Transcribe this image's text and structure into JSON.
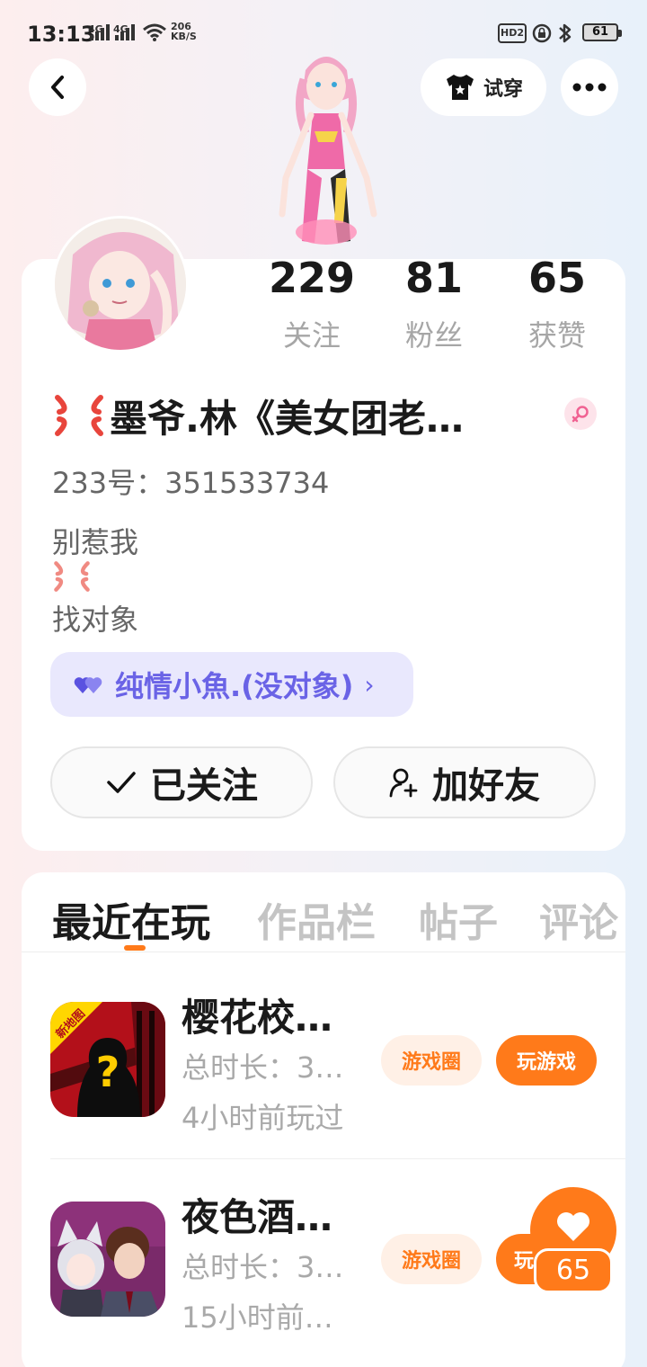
{
  "status_bar": {
    "time": "13:13",
    "network_1": "4G",
    "network_2": "4G",
    "speed_value": "206",
    "speed_unit": "KB/S",
    "hd_label": "HD2",
    "battery": "61"
  },
  "header": {
    "tryon_label": "试穿"
  },
  "profile": {
    "stats": [
      {
        "value": "229",
        "label": "关注"
      },
      {
        "value": "81",
        "label": "粉丝"
      },
      {
        "value": "65",
        "label": "获赞"
      }
    ],
    "name": "墨爷.林《美女团老…",
    "uid": "233号：351533734",
    "bio_line1": "别惹我",
    "bio_line2": "找对象",
    "group_label": "纯情小魚.(没对象)",
    "group_arrow": "›",
    "followed_label": "已关注",
    "add_friend_label": "加好友"
  },
  "tabs": [
    "最近在玩",
    "作品栏",
    "帖子",
    "评论"
  ],
  "games": [
    {
      "title": "樱花校…",
      "badge": "新地图",
      "duration": "总时长：3…",
      "last_played": "4小时前玩过",
      "circle_label": "游戏圈",
      "play_label": "玩游戏"
    },
    {
      "title": "夜色酒…",
      "duration": "总时长：3…",
      "last_played": "15小时前…",
      "circle_label": "游戏圈",
      "play_label": "玩"
    }
  ],
  "like_fab": {
    "count": "65"
  },
  "colors": {
    "accent": "#ff7a1a",
    "group_chip_bg": "#e9e8fd",
    "group_chip_text": "#6a63e6",
    "muted_text": "#a9a9a9"
  }
}
